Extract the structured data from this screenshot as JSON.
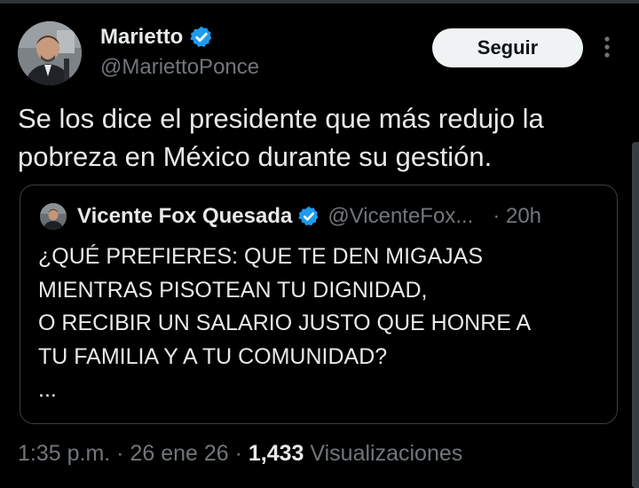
{
  "author": {
    "display_name": "Marietto",
    "handle": "@MariettoPonce",
    "verified": true
  },
  "follow_button": {
    "label": "Seguir"
  },
  "more_icon": "more-vertical-icon",
  "tweet": {
    "text": "Se los dice el presidente que más redujo la pobreza en México durante su gestión."
  },
  "quoted": {
    "display_name": "Vicente Fox Quesada",
    "handle": "@VicenteFox...",
    "time": "· 20h",
    "verified": true,
    "text": "¿QUÉ PREFIERES: QUE TE DEN MIGAJAS\nMIENTRAS PISOTEAN TU DIGNIDAD,\nO RECIBIR UN SALARIO JUSTO QUE HONRE A\nTU FAMILIA Y A TU COMUNIDAD?\n..."
  },
  "meta": {
    "time": "1:35 p.m.",
    "sep1": " · ",
    "date": "26 ene 26",
    "sep2": " · ",
    "views_count": "1,433",
    "views_label": " Visualizaciones"
  },
  "colors": {
    "background": "#000000",
    "verified_badge": "#1d9bf0",
    "secondary_text": "#71767b",
    "follow_button_bg": "#eff3f4"
  }
}
